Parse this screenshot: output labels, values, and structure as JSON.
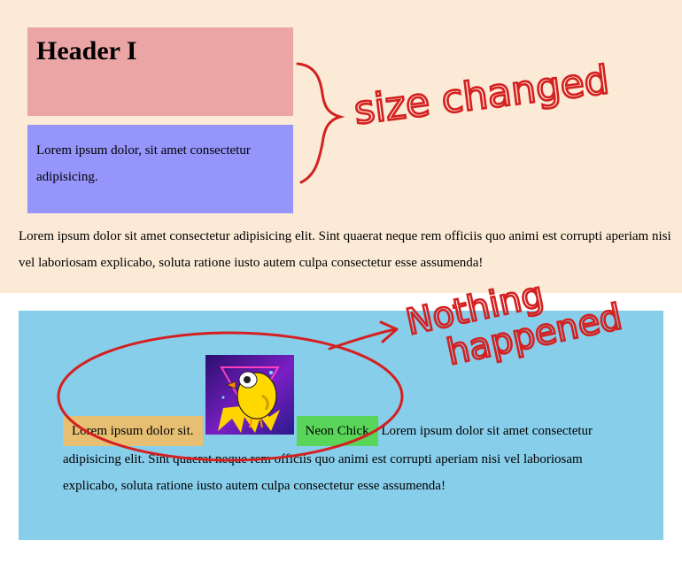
{
  "top": {
    "header": "Header I",
    "box_text": "Lorem ipsum dolor, sit amet consectetur adipisicing.",
    "paragraph": "Lorem ipsum dolor sit amet consectetur adipisicing elit. Sint quaerat neque rem officiis quo animi est corrupti aperiam nisi vel laboriosam explicabo, soluta ratione iusto autem culpa consectetur esse assumenda!"
  },
  "bottom": {
    "orange_label": "Lorem ipsum dolor sit.",
    "green_label": "Neon Chick",
    "paragraph": "Lorem ipsum dolor sit amet consectetur adipisicing elit. Sint quaerat neque rem officiis quo animi est corrupti aperiam nisi vel laboriosam explicabo, soluta ratione iusto autem culpa consectetur esse assumenda!"
  },
  "annotations": {
    "top_note": "size changed",
    "bottom_note_line1": "Nothing",
    "bottom_note_line2": "happened",
    "color": "#d42020"
  },
  "colors": {
    "top_bg": "#fbead6",
    "header_bg": "#eba5a5",
    "box_bg": "#9695fb",
    "bottom_bg": "#87ceeb",
    "orange": "#e6bf73",
    "green": "#59d659"
  },
  "image": {
    "icon": "neon-chick-image"
  }
}
